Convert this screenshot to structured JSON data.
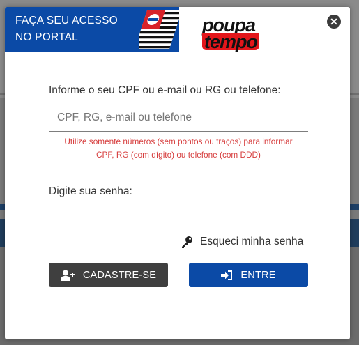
{
  "header": {
    "title_line1": "FAÇA SEU ACESSO",
    "title_line2": "NO PORTAL",
    "flag_icon": "sao-paulo-flag-icon",
    "brand_color": "#0b4aa6"
  },
  "logo": {
    "line1": "poupa",
    "line2": "tempo"
  },
  "close": {
    "icon": "close-icon",
    "glyph": "✕"
  },
  "login_field": {
    "label": "Informe o seu CPF ou e-mail ou RG ou telefone:",
    "placeholder": "CPF, RG, e-mail ou telefone",
    "value": "",
    "hint_line1": "Utilize somente números (sem pontos ou traços) para informar",
    "hint_line2": "CPF, RG (com dígito) ou telefone (com DDD)",
    "hint_color": "#d63c3c"
  },
  "password_field": {
    "label": "Digite sua senha:",
    "value": ""
  },
  "forgot_password": {
    "icon": "key-icon",
    "label": "Esqueci minha senha"
  },
  "buttons": {
    "register_label": "CADASTRE-SE",
    "register_icon": "user-plus-icon",
    "register_color": "#3f3f3f",
    "enter_label": "ENTRE",
    "enter_icon": "sign-in-icon",
    "enter_color": "#0b4aa6"
  }
}
